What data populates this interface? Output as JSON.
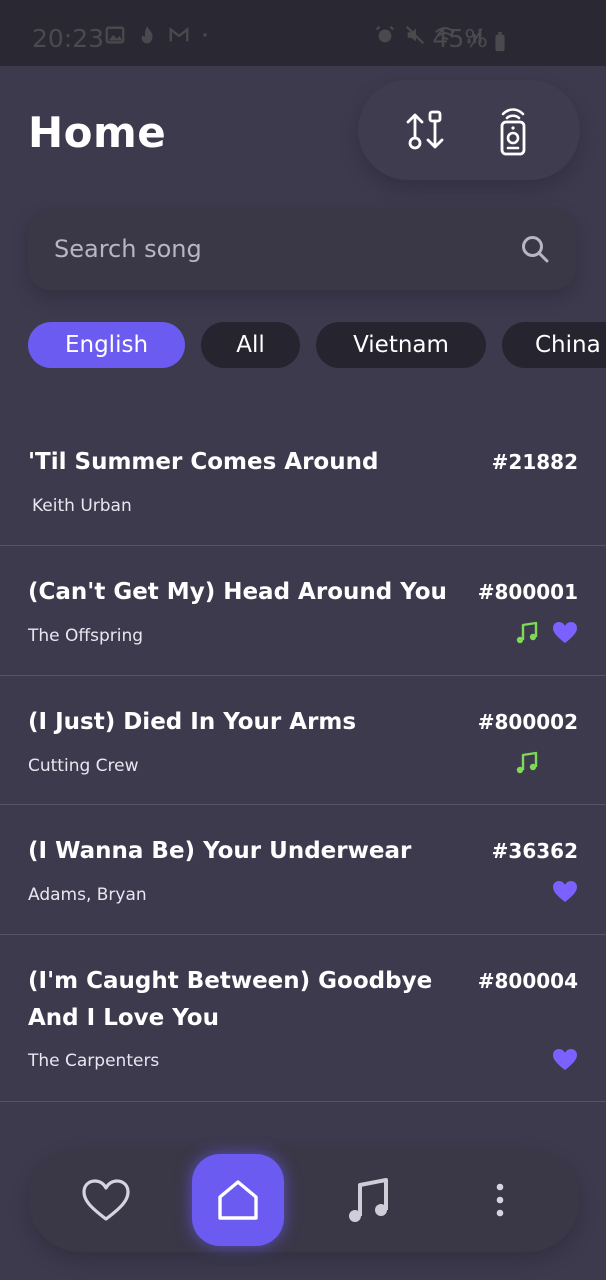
{
  "status_bar": {
    "time": "20:23",
    "battery": "45%",
    "left_icons": [
      "image-icon",
      "fire-icon",
      "gmail-icon",
      "dot-icon"
    ],
    "right_icons": [
      "alarm-icon",
      "mute-icon",
      "wifi-icon",
      "signal-icon",
      "battery-icon"
    ]
  },
  "header": {
    "title": "Home",
    "actions": [
      "sort-icon",
      "remote-icon"
    ]
  },
  "search": {
    "placeholder": "Search song"
  },
  "chips": [
    {
      "label": "English",
      "active": true
    },
    {
      "label": "All",
      "active": false
    },
    {
      "label": "Vietnam",
      "active": false
    },
    {
      "label": "China",
      "active": false
    }
  ],
  "songs": [
    {
      "title": "'Til Summer Comes Around",
      "artist": "Keith Urban",
      "number": "#21882",
      "music_icon": false,
      "favorite": false
    },
    {
      "title": "(Can't Get My) Head Around You",
      "artist": "The Offspring",
      "number": "#800001",
      "music_icon": true,
      "favorite": true
    },
    {
      "title": "(I Just) Died In Your Arms",
      "artist": "Cutting Crew",
      "number": "#800002",
      "music_icon": true,
      "favorite": false
    },
    {
      "title": "(I Wanna Be) Your Underwear",
      "artist": "Adams, Bryan",
      "number": "#36362",
      "music_icon": false,
      "favorite": true
    },
    {
      "title": "(I'm Caught Between) Goodbye And I Love You",
      "artist": "The Carpenters",
      "number": "#800004",
      "music_icon": false,
      "favorite": true
    }
  ],
  "bottom_nav": {
    "items": [
      "heart-icon",
      "home-icon",
      "music-note-icon",
      "more-vertical-icon"
    ],
    "active": "home-icon"
  },
  "colors": {
    "background": "#3d3a4e",
    "accent": "#6b5bf0",
    "music_green": "#7ed957",
    "favorite_purple": "#7b61ff"
  }
}
